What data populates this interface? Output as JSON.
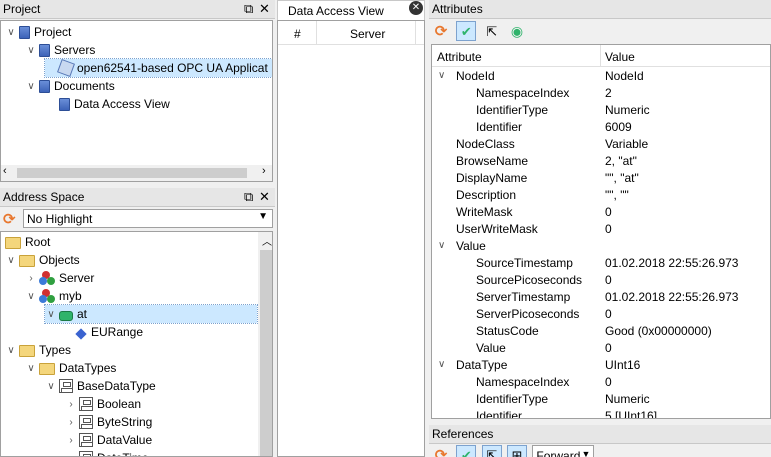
{
  "project_dock": {
    "title": "Project",
    "float_icon": "float-icon",
    "close_icon": "close-icon"
  },
  "project_tree": [
    {
      "label": "Project",
      "icon": "project-icon",
      "expanded": true
    },
    {
      "label": "Servers",
      "icon": "project-icon",
      "expanded": true
    },
    {
      "label": "open62541-based OPC UA Applicat",
      "icon": "server-icon"
    },
    {
      "label": "Documents",
      "icon": "project-icon",
      "expanded": true
    },
    {
      "label": "Data Access View",
      "icon": "project-icon"
    }
  ],
  "address_dock": {
    "title": "Address Space"
  },
  "address_toolbar": {
    "refresh_icon": "refresh-icon",
    "highlight_value": "No Highlight"
  },
  "address_tree": [
    {
      "label": "Root",
      "icon": "folder-icon"
    },
    {
      "label": "Objects",
      "icon": "folder-icon"
    },
    {
      "label": "Server",
      "icon": "object-icon"
    },
    {
      "label": "myb",
      "icon": "object-icon"
    },
    {
      "label": "at",
      "icon": "variable-icon"
    },
    {
      "label": "EURange",
      "icon": "property-icon"
    },
    {
      "label": "Types",
      "icon": "folder-icon"
    },
    {
      "label": "DataTypes",
      "icon": "folder-icon"
    },
    {
      "label": "BaseDataType",
      "icon": "datatype-icon"
    },
    {
      "label": "Boolean",
      "icon": "datatype-icon"
    },
    {
      "label": "ByteString",
      "icon": "datatype-icon"
    },
    {
      "label": "DataValue",
      "icon": "datatype-icon"
    },
    {
      "label": "DateTime",
      "icon": "datatype-icon"
    }
  ],
  "dav_tab": {
    "label": "Data Access View",
    "close_icon": "close-circle-icon"
  },
  "dav_table": {
    "columns": [
      "#",
      "Server"
    ]
  },
  "attributes_dock": {
    "title": "Attributes"
  },
  "attributes_toolbar": {
    "icons": [
      "refresh-icon",
      "check-icon",
      "cursor-icon",
      "record-icon"
    ]
  },
  "attributes_table": {
    "columns": [
      "Attribute",
      "Value"
    ],
    "rows": [
      {
        "name": "NodeId",
        "value": "NodeId",
        "level": 0,
        "expander": true
      },
      {
        "name": "NamespaceIndex",
        "value": "2",
        "level": 1
      },
      {
        "name": "IdentifierType",
        "value": "Numeric",
        "level": 1
      },
      {
        "name": "Identifier",
        "value": "6009",
        "level": 1
      },
      {
        "name": "NodeClass",
        "value": "Variable",
        "level": 0
      },
      {
        "name": "BrowseName",
        "value": "2, \"at\"",
        "level": 0
      },
      {
        "name": "DisplayName",
        "value": "\"\", \"at\"",
        "level": 0
      },
      {
        "name": "Description",
        "value": "\"\", \"\"",
        "level": 0
      },
      {
        "name": "WriteMask",
        "value": "0",
        "level": 0
      },
      {
        "name": "UserWriteMask",
        "value": "0",
        "level": 0
      },
      {
        "name": "Value",
        "value": "",
        "level": 0,
        "expander": true
      },
      {
        "name": "SourceTimestamp",
        "value": "01.02.2018 22:55:26.973",
        "level": 1
      },
      {
        "name": "SourcePicoseconds",
        "value": "0",
        "level": 1
      },
      {
        "name": "ServerTimestamp",
        "value": "01.02.2018 22:55:26.973",
        "level": 1
      },
      {
        "name": "ServerPicoseconds",
        "value": "0",
        "level": 1
      },
      {
        "name": "StatusCode",
        "value": "Good (0x00000000)",
        "level": 1
      },
      {
        "name": "Value",
        "value": "0",
        "level": 1
      },
      {
        "name": "DataType",
        "value": "UInt16",
        "level": 0,
        "expander": true
      },
      {
        "name": "NamespaceIndex",
        "value": "0",
        "level": 1
      },
      {
        "name": "IdentifierType",
        "value": "Numeric",
        "level": 1
      },
      {
        "name": "Identifier",
        "value": "5 [UInt16]",
        "level": 1
      }
    ]
  },
  "references_dock": {
    "title": "References",
    "direction_value": "Forward"
  },
  "colors": {
    "selection": "#cce8ff",
    "selection_border": "#7da2ce",
    "accent_orange": "#e8772e",
    "accent_green": "#2fb36b"
  }
}
